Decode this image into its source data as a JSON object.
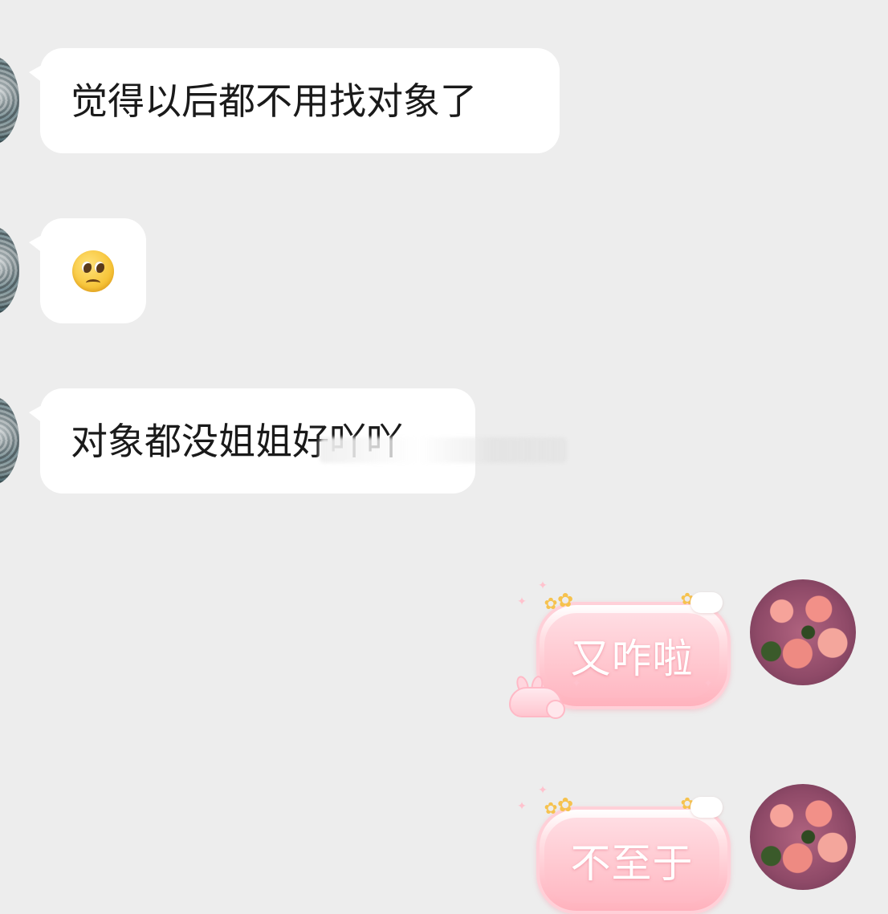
{
  "chat": {
    "received": [
      {
        "kind": "text",
        "text": "觉得以后都不用找对象了"
      },
      {
        "kind": "emoji",
        "icon": "pleading-face-emoji"
      },
      {
        "kind": "text",
        "text": "对象都没姐姐好吖吖"
      }
    ],
    "sent": [
      {
        "kind": "text",
        "text": "又咋啦"
      },
      {
        "kind": "text",
        "text": "不至于"
      }
    ]
  },
  "colors": {
    "background": "#ededed",
    "received_bubble": "#ffffff",
    "sent_bubble": "#ffc3cc",
    "sent_text": "#ffffff"
  }
}
